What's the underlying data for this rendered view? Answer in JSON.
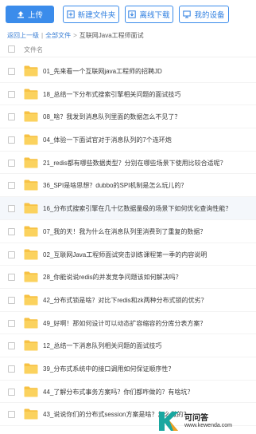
{
  "toolbar": {
    "upload_label": "上传",
    "new_folder_label": "新建文件夹",
    "offline_download_label": "离线下载",
    "my_device_label": "我的设备"
  },
  "breadcrumb": {
    "back": "返回上一级",
    "all_files": "全部文件",
    "current": "互联网Java工程师面试"
  },
  "list": {
    "column_header": "文件名",
    "items": [
      "01_先来看一个互联网java工程师的招聘JD",
      "18_总结一下分布式搜索引擎相关问题的面试技巧",
      "08_啥？我发到消息队列里面的数据怎么不见了？",
      "04_体验一下面试官对于消息队列的7个连环炮",
      "21_redis都有哪些数据类型？分别在哪些场景下使用比较合适呢？",
      "36_SPI是啥思想？dubbo的SPI机制是怎么玩儿的？",
      "16_分布式搜索引擎在几十亿数据量级的场景下如何优化查询性能？",
      "07_我的天！我为什么在消息队列里消费到了重复的数据？",
      "02_互联网Java工程师面试突击训练课程第一季的内容说明",
      "28_你能说说redis的并发竞争问题该如何解决吗？",
      "42_分布式锁是啥？对比下redis和zk两种分布式锁的优劣？",
      "49_好啊！那如何设计可以动态扩容缩容的分库分表方案？",
      "12_总结一下消息队列相关问题的面试技巧",
      "39_分布式系统中的接口调用如何保证顺序性？",
      "44_了解分布式事务方案吗？你们都咋做的？有啥坑？",
      "43_说说你们的分布式session方案是啥？怎么做的？"
    ]
  },
  "watermark": {
    "title": "可问答",
    "url": "www.kewenda.com"
  },
  "colors": {
    "accent": "#3b8ceb",
    "folder": "#f7c244",
    "link": "#3b7fd4"
  }
}
